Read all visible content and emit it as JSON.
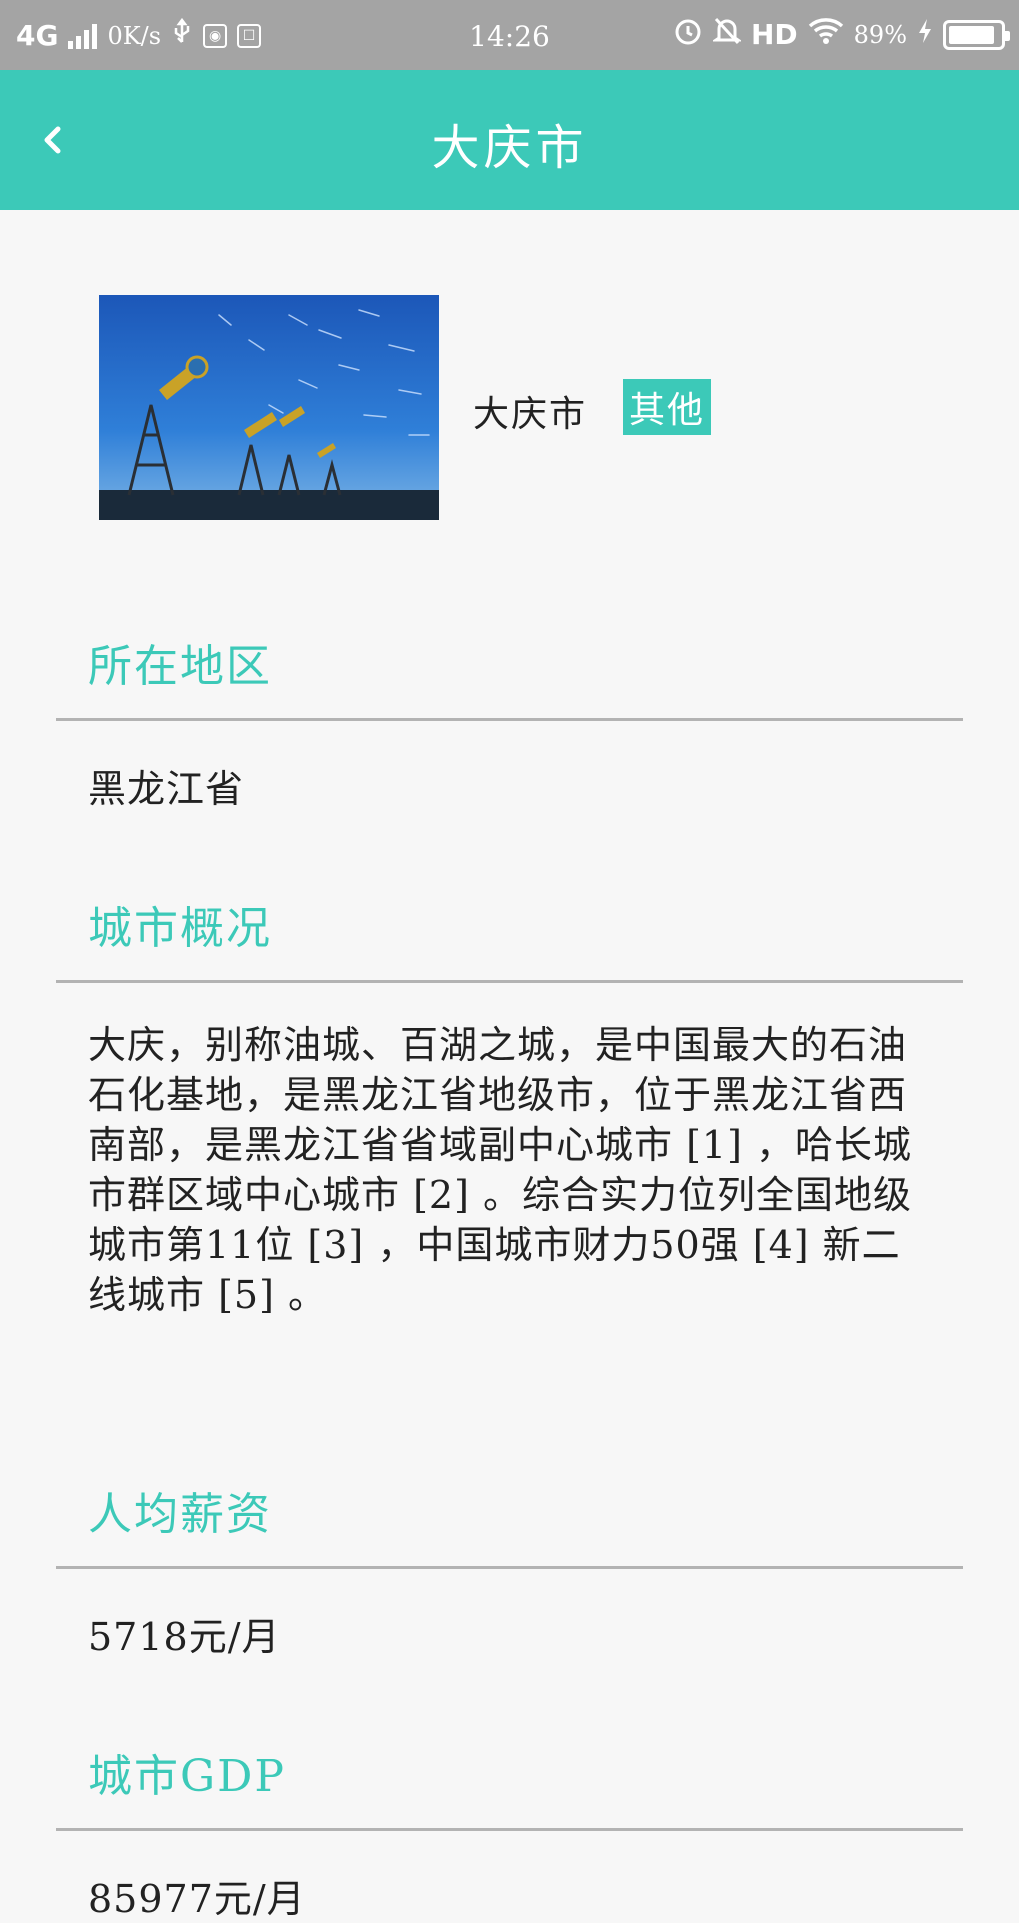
{
  "status_bar": {
    "network": "4G",
    "speed": "0K/s",
    "time": "14:26",
    "hd": "HD",
    "battery": "89%",
    "battery_level": 0.89
  },
  "app_bar": {
    "title": "大庆市"
  },
  "city": {
    "name": "大庆市",
    "tag": "其他"
  },
  "sections": {
    "region": {
      "title": "所在地区",
      "value": "黑龙江省"
    },
    "overview": {
      "title": "城市概况",
      "text": "大庆，别称油城、百湖之城，是中国最大的石油石化基地，是黑龙江省地级市，位于黑龙江省西南部，是黑龙江省省域副中心城市 [1] ，哈长城市群区域中心城市 [2] 。综合实力位列全国地级城市第11位 [3] ，中国城市财力50强 [4] 新二线城市 [5] 。"
    },
    "salary": {
      "title": "人均薪资",
      "value": "5718元/月"
    },
    "gdp": {
      "title": "城市GDP",
      "value": "85977元/月"
    }
  },
  "colors": {
    "accent": "#3cc9b8",
    "status_bar": "#a4a4a4",
    "background": "#f7f7f7"
  }
}
